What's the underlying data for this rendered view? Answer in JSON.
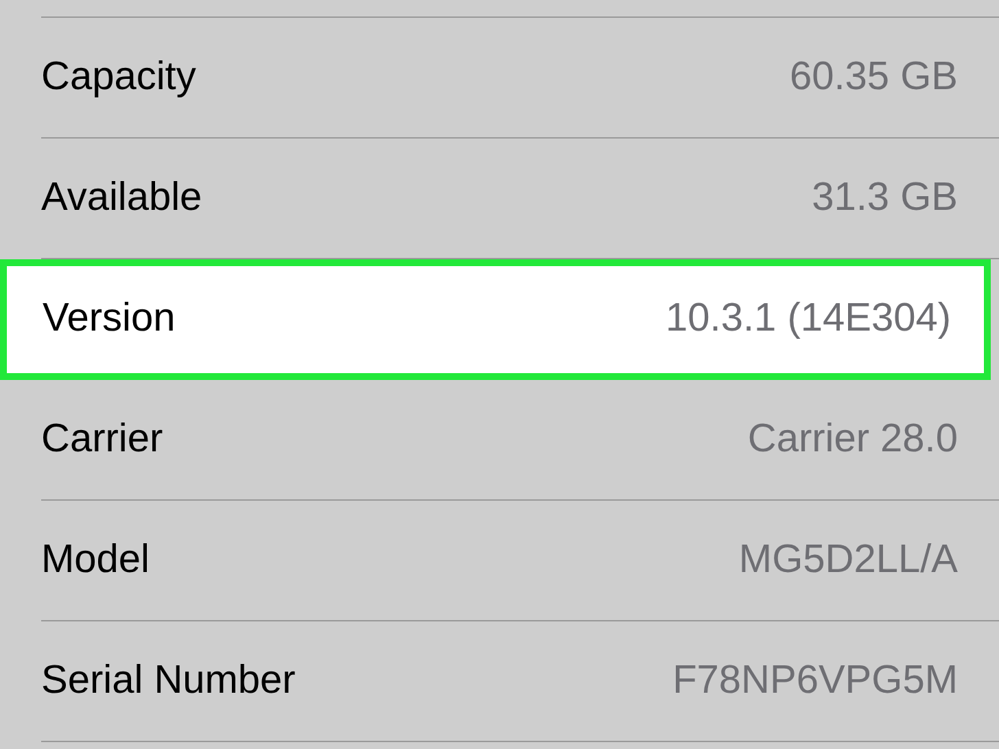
{
  "rows": [
    {
      "label": "Capacity",
      "value": "60.35 GB",
      "highlighted": false
    },
    {
      "label": "Available",
      "value": "31.3 GB",
      "highlighted": false
    },
    {
      "label": "Version",
      "value": "10.3.1 (14E304)",
      "highlighted": true
    },
    {
      "label": "Carrier",
      "value": "Carrier 28.0",
      "highlighted": false
    },
    {
      "label": "Model",
      "value": "MG5D2LL/A",
      "highlighted": false
    },
    {
      "label": "Serial Number",
      "value": "F78NP6VPG5M",
      "highlighted": false
    }
  ]
}
